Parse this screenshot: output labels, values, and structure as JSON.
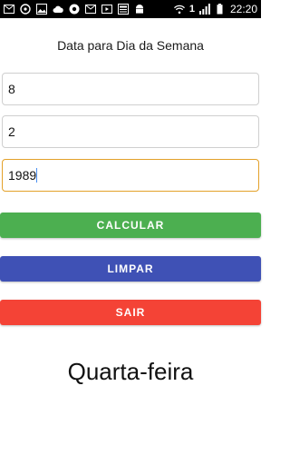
{
  "statusbar": {
    "time": "22:20",
    "sim_badge": "1",
    "left_icons": [
      "mail-icon",
      "whatsapp-icon",
      "gallery-icon",
      "cloud-icon",
      "chrome-icon",
      "mail-icon",
      "video-icon",
      "news-icon",
      "android-icon"
    ],
    "right_icons": [
      "wifi-icon",
      "signal-icon",
      "battery-icon"
    ]
  },
  "app": {
    "title": "Data para Dia da Semana",
    "day_value": "8",
    "month_value": "2",
    "year_value": "1989",
    "calcular_label": "CALCULAR",
    "limpar_label": "LIMPAR",
    "sair_label": "SAIR",
    "result": "Quarta-feira"
  },
  "colors": {
    "calcular": "#4caf50",
    "limpar": "#3f51b5",
    "sair": "#f44336",
    "active_border": "#e3a12a"
  }
}
